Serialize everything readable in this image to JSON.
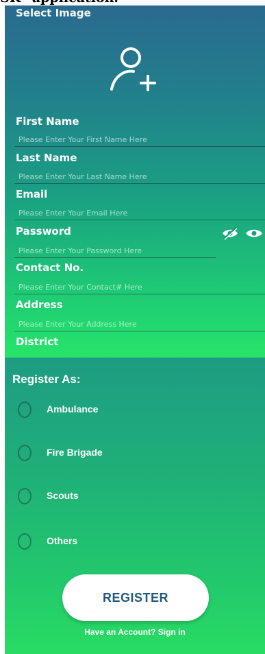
{
  "caption": "SK\" application.",
  "registration": {
    "select_image_label": "Select Image",
    "avatar_icon": "add-user-icon",
    "fields": [
      {
        "label": "First Name",
        "placeholder": "Please Enter Your First Name Here"
      },
      {
        "label": "Last Name",
        "placeholder": "Please Enter Your Last Name Here"
      },
      {
        "label": "Email",
        "placeholder": "Please Enter Your Email Here"
      },
      {
        "label": "Password",
        "placeholder": "Please Enter Your Password Here"
      },
      {
        "label": "Contact No.",
        "placeholder": "Please Enter Your Contact# Here"
      },
      {
        "label": "Address",
        "placeholder": "Please Enter Your Address Here"
      },
      {
        "label": "District",
        "placeholder": ""
      }
    ],
    "password_icons": [
      "eye-off-icon",
      "eye-icon"
    ]
  },
  "register_as": {
    "title": "Register As:",
    "options": [
      "Ambulance",
      "Fire Brigade",
      "Scouts",
      "Others"
    ],
    "selected": null
  },
  "register_button": "REGISTER",
  "signin_text": "Have an Account? Sign in",
  "colors": {
    "gradient_top": "#2a6a8f",
    "gradient_bottom": "#28e46a",
    "button_text": "#1f5a78",
    "text": "#ffffff"
  }
}
